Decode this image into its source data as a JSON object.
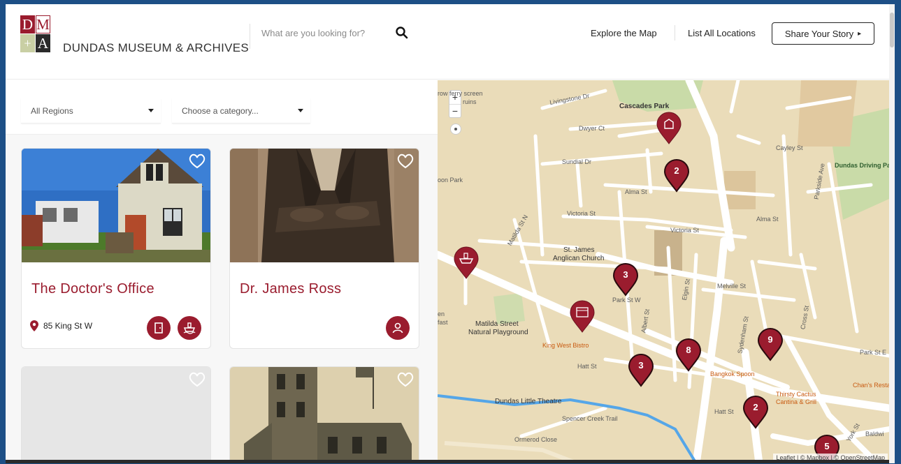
{
  "logo": {
    "letters": [
      "D",
      "M",
      "+",
      "A"
    ],
    "name": "DUNDAS MUSEUM & ARCHIVES"
  },
  "search": {
    "placeholder": "What are you looking for?",
    "icon": "search-icon"
  },
  "nav": {
    "explore": "Explore the Map",
    "list": "List All Locations",
    "share": "Share Your Story",
    "share_arrow": "▸"
  },
  "filters": {
    "region": "All Regions",
    "category": "Choose a category..."
  },
  "cards": [
    {
      "title": "The Doctor's Office",
      "address": "85 King St W",
      "icons": [
        "door-icon",
        "boat-icon"
      ]
    },
    {
      "title": "Dr. James Ross",
      "address": "",
      "icons": [
        "person-icon"
      ]
    },
    {
      "title": "",
      "address": "",
      "icons": []
    },
    {
      "title": "",
      "address": "",
      "icons": []
    }
  ],
  "map": {
    "zoom_in": "+",
    "zoom_out": "−",
    "labels": {
      "cascades_park": "Cascades Park",
      "livingstone": "Livingstone Dr",
      "dwyer": "Dwyer Ct",
      "sundial": "Sundial Dr",
      "cayley": "Cayley St",
      "dundas_driving": "Dundas Driving Pa",
      "alma1": "Alma St",
      "alma2": "Alma St",
      "victoria1": "Victoria St",
      "victoria2": "Victoria St",
      "st_james1": "St. James",
      "st_james2": "Anglican Church",
      "melville": "Melville St",
      "park_st": "Park St W",
      "matilda_pg1": "Matilda Street",
      "matilda_pg2": "Natural Playground",
      "king_west": "King West Bistro",
      "hatt1": "Hatt St",
      "hatt2": "Hatt St",
      "bangkok": "Bangkok Spoon",
      "thirsty1": "Thirsty Cactus",
      "thirsty2": "Cantina & Grill",
      "chans": "Chan's Restau",
      "dundas_theatre": "Dundas Little Theatre",
      "spencer": "Spencer Creek Trail",
      "ormerod": "Ormerod Close",
      "baldwin": "Baldwi",
      "york": "York St",
      "sydenham": "Sydenham St",
      "elgin": "Elgin St",
      "albert": "Albert St",
      "cross": "Cross St",
      "parkside": "Parkside Ave",
      "matilda_st": "Matilda St N",
      "ferry1": "row ferry screen",
      "ferry2": "ruins",
      "moon_park": "oon Park",
      "en": "en",
      "fast": "fast",
      "park_st_e": "Park St E"
    },
    "attribution": "Leaflet | © Mapbox | © OpenStreetMap",
    "pins": [
      {
        "label": "",
        "icon": "museum-pin-icon"
      },
      {
        "label": "2",
        "icon": ""
      },
      {
        "label": "",
        "icon": "boat-pin-icon"
      },
      {
        "label": "3",
        "icon": ""
      },
      {
        "label": "",
        "icon": "building-pin-icon"
      },
      {
        "label": "3",
        "icon": ""
      },
      {
        "label": "8",
        "icon": ""
      },
      {
        "label": "9",
        "icon": ""
      },
      {
        "label": "2",
        "icon": ""
      },
      {
        "label": "5",
        "icon": ""
      }
    ]
  },
  "colors": {
    "accent": "#9a1c2e",
    "map_bg": "#eadcb9",
    "frame": "#1d4f86"
  }
}
